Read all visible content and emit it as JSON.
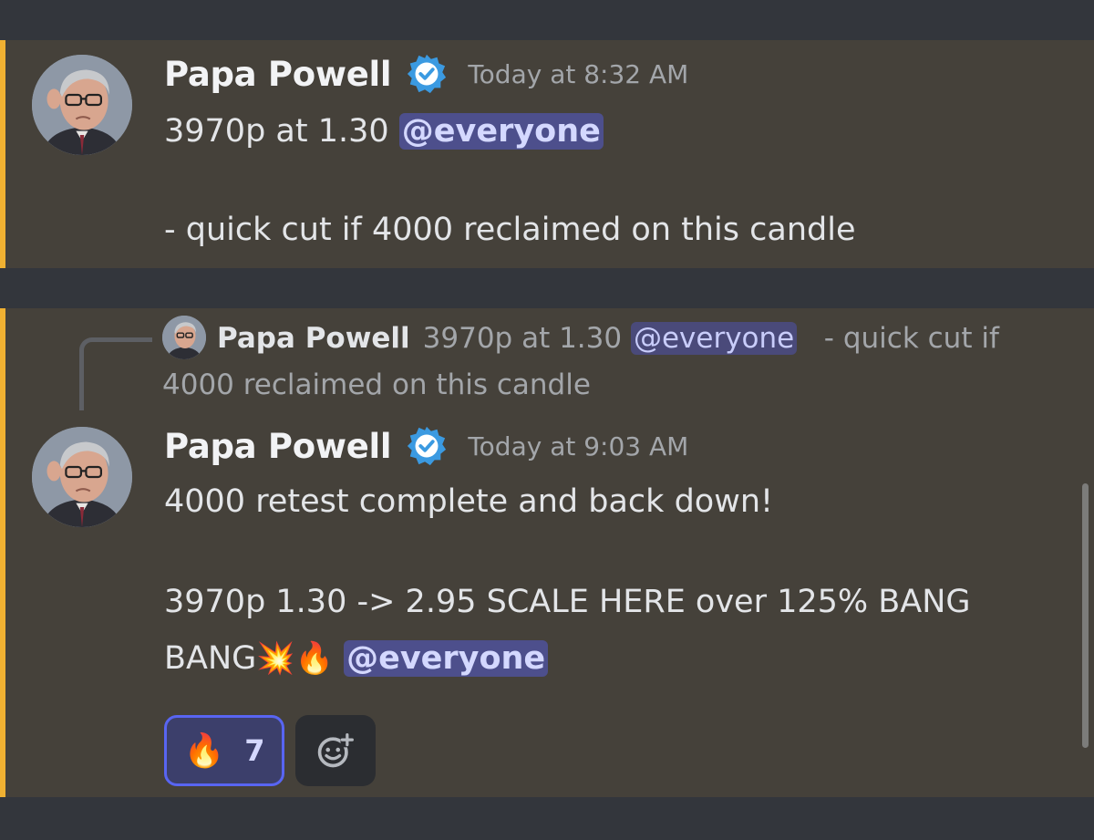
{
  "messages": [
    {
      "username": "Papa Powell",
      "timestamp": "Today at 8:32 AM",
      "line1_text": "3970p at 1.30 ",
      "line1_mention": "@everyone",
      "line2_text": "- quick cut if 4000 reclaimed on this candle"
    },
    {
      "reply": {
        "username": "Papa Powell",
        "text_before": "3970p at 1.30 ",
        "mention": "@everyone",
        "text_after": "   - quick cut if 4000 reclaimed on this candle"
      },
      "username": "Papa Powell",
      "timestamp": "Today at 9:03 AM",
      "line1": "4000 retest complete and back down!",
      "line2": "3970p 1.30 -> 2.95 SCALE HERE over 125% BANG",
      "line3_text": "BANG",
      "line3_emojis": "💥🔥",
      "line3_mention": "@everyone",
      "reactions": [
        {
          "emoji": "🔥",
          "count": "7"
        }
      ]
    }
  ],
  "icons": {
    "verified": "verified-badge-icon",
    "add_reaction": "add-reaction-icon"
  },
  "colors": {
    "accent": "#f0b132",
    "mention_bg": "#4d4f8c",
    "verified": "#3b9ae1",
    "reaction_border": "#5865f2"
  }
}
